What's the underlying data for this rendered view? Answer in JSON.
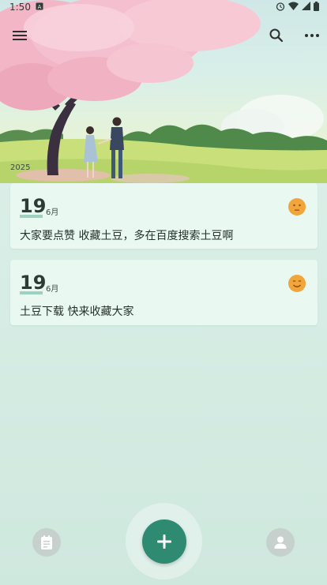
{
  "status_bar": {
    "time": "1:50"
  },
  "header": {
    "year": "2025"
  },
  "entries": [
    {
      "day": "19",
      "month": "6月",
      "mood_icon": "neutral-face-icon",
      "text": "大家要点赞 收藏土豆，多在百度搜索土豆啊"
    },
    {
      "day": "19",
      "month": "6月",
      "mood_icon": "smile-face-icon",
      "text": "土豆下载   快来收藏大家"
    }
  ],
  "colors": {
    "accent": "#2e8b72",
    "card_bg": "#e9f8f1",
    "mood": "#f2a53a"
  }
}
